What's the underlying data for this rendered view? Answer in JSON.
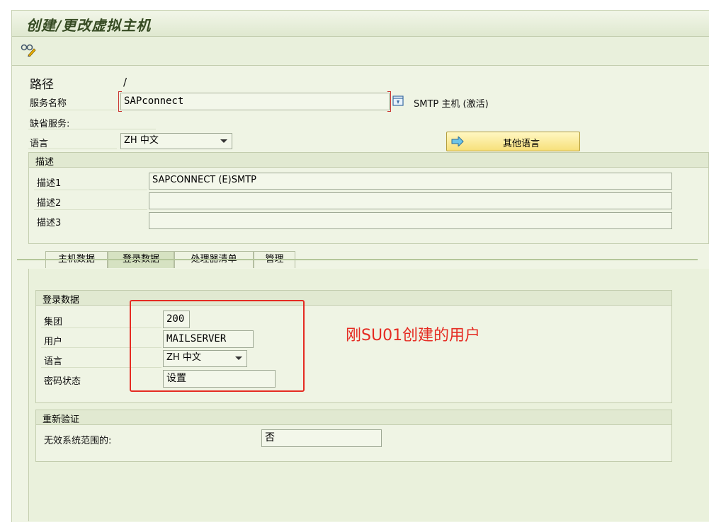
{
  "window": {
    "title": "创建/更改虚拟主机"
  },
  "header": {
    "path_label": "路径",
    "path_value": "/",
    "service_name_label": "服务名称",
    "service_name_value": "SAPconnect",
    "service_info": "SMTP 主机 (激活)",
    "default_service_label": "缺省服务:",
    "language_label": "语言",
    "language_value": "ZH 中文",
    "other_languages_button": "其他语言"
  },
  "description": {
    "title": "描述",
    "rows": [
      {
        "label": "描述1",
        "value": "SAPCONNECT (E)SMTP"
      },
      {
        "label": "描述2",
        "value": ""
      },
      {
        "label": "描述3",
        "value": ""
      }
    ]
  },
  "tabs": [
    {
      "label": "主机数据",
      "active": false
    },
    {
      "label": "登录数据",
      "active": true
    },
    {
      "label": "处理器清单",
      "active": false
    },
    {
      "label": "管理",
      "active": false
    }
  ],
  "logon": {
    "title": "登录数据",
    "client_label": "集团",
    "client_value": "200",
    "user_label": "用户",
    "user_value": "MAILSERVER",
    "language_label": "语言",
    "language_value": "ZH 中文",
    "password_status_label": "密码状态",
    "password_status_value": "设置"
  },
  "reauth": {
    "title": "重新验证",
    "invalid_range_label": "无效系统范围的:",
    "invalid_range_value": "否"
  },
  "annotation": {
    "text": "刚SU01创建的用户",
    "color": "#e52b22"
  },
  "colors": {
    "background": "#eff4e4",
    "button": "#f7e07a",
    "annotation": "#e52b22"
  },
  "icons": {
    "toolbar": "display-change-glasses-icon",
    "service_info": "service-info-icon",
    "other_lang": "arrow-right-icon"
  }
}
